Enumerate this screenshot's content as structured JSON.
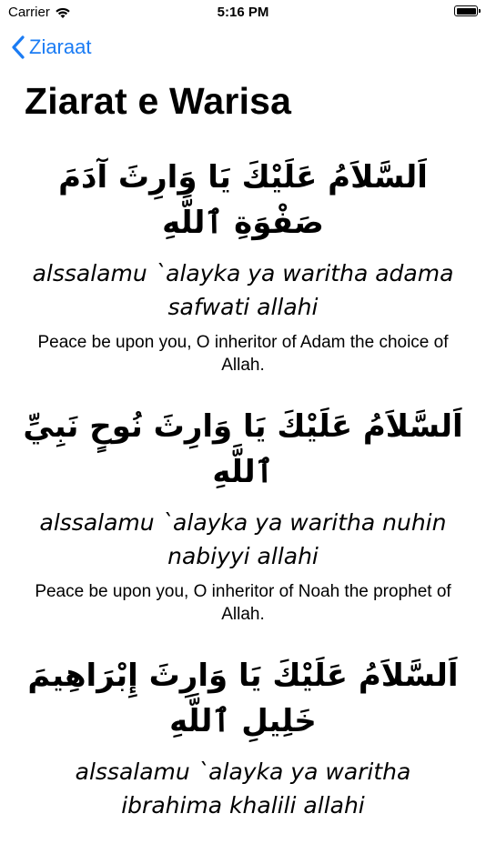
{
  "status_bar": {
    "carrier": "Carrier",
    "time": "5:16 PM"
  },
  "nav": {
    "back_label": "Ziaraat"
  },
  "page": {
    "title": "Ziarat e Warisa"
  },
  "verses": [
    {
      "arabic": "اَلسَّلاَمُ عَلَيْكَ يَا وَارِثَ آدَمَ صَفْوَةِ ٱللَّهِ",
      "transliteration": "alssalamu `alayka ya waritha adama safwati allahi",
      "translation": "Peace be upon you, O inheritor of Adam the choice of Allah."
    },
    {
      "arabic": "اَلسَّلاَمُ عَلَيْكَ يَا وَارِثَ نُوحٍ نَبِيِّ ٱللَّهِ",
      "transliteration": "alssalamu `alayka ya waritha nuhin nabiyyi allahi",
      "translation": "Peace be upon you, O inheritor of Noah the prophet of Allah."
    },
    {
      "arabic": "اَلسَّلاَمُ عَلَيْكَ يَا وَارِثَ إِبْرَاهِيمَ خَلِيلِ ٱللَّهِ",
      "transliteration": "alssalamu `alayka ya waritha ibrahima khalili allahi",
      "translation": ""
    }
  ],
  "colors": {
    "accent": "#1b7cf4",
    "text": "#000000",
    "background": "#ffffff"
  },
  "icons": [
    "wifi-icon",
    "battery-icon",
    "chevron-left-icon"
  ]
}
